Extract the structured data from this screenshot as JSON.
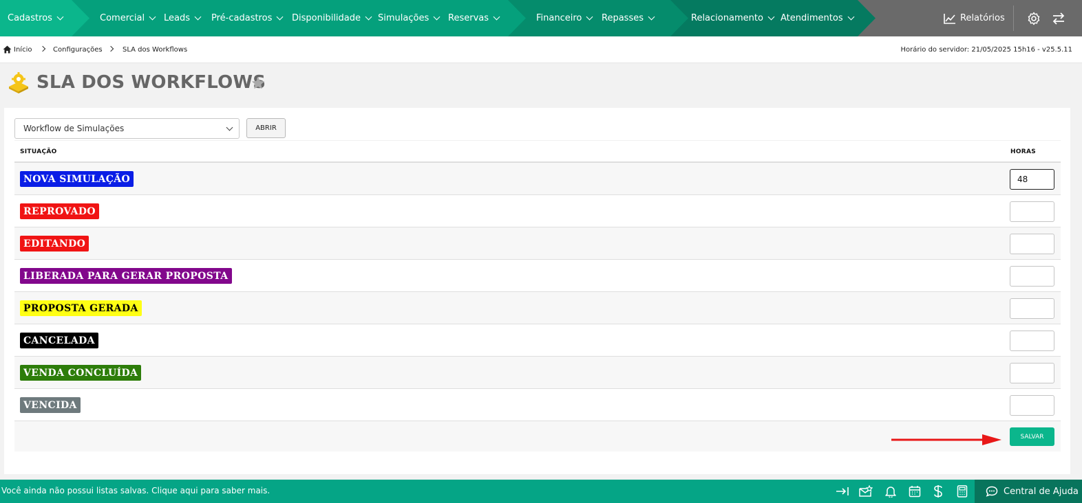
{
  "nav": {
    "items": [
      "Cadastros",
      "Comercial",
      "Leads",
      "Pré-cadastros",
      "Disponibilidade",
      "Simulações",
      "Reservas",
      "Financeiro",
      "Repasses",
      "Relacionamento",
      "Atendimentos"
    ],
    "reports": "Relatórios",
    "colors": {
      "seg1": "#0bb68c",
      "seg2": "#05a07c",
      "seg3": "#058c6c",
      "seg4": "#057a60",
      "right": "#6a6a6a"
    }
  },
  "breadcrumb": {
    "home": "Início",
    "level1": "Configurações",
    "level2": "SLA dos Workflows",
    "server_time": "Horário do servidor: 21/05/2025 15h16 - v25.5.11"
  },
  "page": {
    "title": "SLA DOS WORKFLOWS"
  },
  "form": {
    "workflow_select": "Workflow de Simulações",
    "open_button": "ABRIR",
    "col_status": "SITUAÇÃO",
    "col_hours": "HORAS",
    "save_button": "SALVAR"
  },
  "rows": [
    {
      "label": "NOVA SIMULAÇÃO",
      "bg": "#0a1ee6",
      "fg": "#ffffff",
      "hours": "48"
    },
    {
      "label": "REPROVADO",
      "bg": "#f01414",
      "fg": "#ffffff",
      "hours": ""
    },
    {
      "label": "EDITANDO",
      "bg": "#f01414",
      "fg": "#ffffff",
      "hours": ""
    },
    {
      "label": "LIBERADA PARA GERAR PROPOSTA",
      "bg": "#82078c",
      "fg": "#ffffff",
      "hours": ""
    },
    {
      "label": "PROPOSTA GERADA",
      "bg": "#ffff14",
      "fg": "#000000",
      "hours": ""
    },
    {
      "label": "CANCELADA",
      "bg": "#000000",
      "fg": "#ffffff",
      "hours": ""
    },
    {
      "label": "VENDA CONCLUÍDA",
      "bg": "#2d7d0a",
      "fg": "#ffffff",
      "hours": ""
    },
    {
      "label": "VENCIDA",
      "bg": "#6e7a7d",
      "fg": "#ffffff",
      "hours": ""
    }
  ],
  "footer": {
    "message": "Você ainda não possui listas salvas. Clique aqui para saber mais.",
    "help": "Central de Ajuda",
    "icons": [
      "collapse-right-icon",
      "mail-star-icon",
      "bell-icon",
      "calendar-icon",
      "dollar-icon",
      "calculator-icon",
      "chat-icon"
    ]
  },
  "accent": "#0bb68c"
}
